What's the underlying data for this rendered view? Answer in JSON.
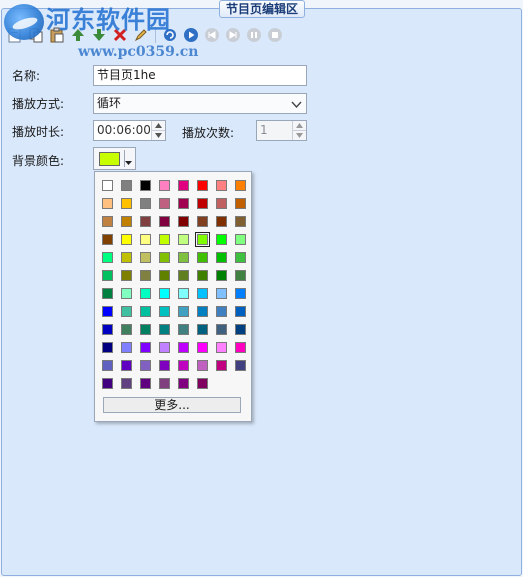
{
  "panel_title": "节目页编辑区",
  "watermark": {
    "title": "河东软件园",
    "url": "www.pc0359.cn"
  },
  "toolbar": {
    "icons": [
      "new-page-icon",
      "copy-icon",
      "paste-icon",
      "move-up-icon",
      "move-down-icon",
      "delete-icon",
      "edit-icon",
      "refresh-icon",
      "play-icon",
      "previous-icon",
      "next-icon",
      "pause-icon",
      "stop-icon"
    ]
  },
  "form": {
    "name_label": "名称:",
    "name_value": "节目页1he",
    "mode_label": "播放方式:",
    "mode_value": "循环",
    "duration_label": "播放时长:",
    "duration_value": "00:06:00",
    "count_label": "播放次数:",
    "count_value": "1",
    "bg_label": "背景颜色:",
    "bg_color": "#c8ff00"
  },
  "palette": {
    "more_label": "更多...",
    "selected_index": 29,
    "colors": [
      "#ffffff",
      "#808080",
      "#000000",
      "#ff80c0",
      "#e0007f",
      "#ff0000",
      "#ff8080",
      "#ff8000",
      "#ffc080",
      "#ffc000",
      "#808080",
      "#c06080",
      "#a0004f",
      "#c00000",
      "#c06060",
      "#c06000",
      "#c08040",
      "#c08000",
      "#804040",
      "#800040",
      "#800000",
      "#804020",
      "#803000",
      "#806030",
      "#804000",
      "#ffff00",
      "#ffff80",
      "#c0ff00",
      "#c0ff80",
      "#80ff00",
      "#00ff00",
      "#80ff80",
      "#00ff80",
      "#c0c000",
      "#c0c060",
      "#80c000",
      "#80c040",
      "#40c000",
      "#00c000",
      "#40c040",
      "#00c060",
      "#808000",
      "#808040",
      "#608000",
      "#608020",
      "#408000",
      "#008000",
      "#408040",
      "#008040",
      "#80ffc0",
      "#00ffc0",
      "#00ffff",
      "#80ffff",
      "#00c0ff",
      "#80c0ff",
      "#0080ff",
      "#0000ff",
      "#40c0a0",
      "#00c0a0",
      "#00c0c0",
      "#40a0c0",
      "#0080c0",
      "#4080c0",
      "#0060c0",
      "#0000c0",
      "#408060",
      "#008060",
      "#008080",
      "#408080",
      "#006080",
      "#406080",
      "#004080",
      "#000080",
      "#8080ff",
      "#8000ff",
      "#c080ff",
      "#c000ff",
      "#ff00ff",
      "#ff80ff",
      "#ff00c0",
      "#6060c0",
      "#6000c0",
      "#8060c0",
      "#8000c0",
      "#c000c0",
      "#c060c0",
      "#c00080",
      "#404080",
      "#400080",
      "#604080",
      "#600080",
      "#804080",
      "#800080",
      "#800060"
    ]
  }
}
